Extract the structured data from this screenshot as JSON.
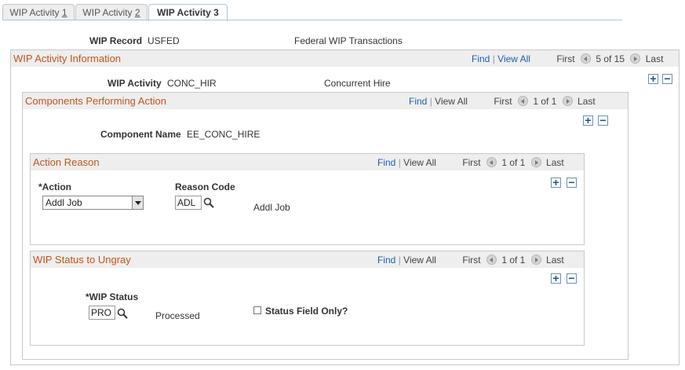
{
  "tabs": [
    {
      "prefix": "WIP Activity ",
      "hot": "1"
    },
    {
      "prefix": "WIP Activity ",
      "hot": "2"
    },
    {
      "label": "WIP Activity 3"
    }
  ],
  "header": {
    "wip_record_label": "WIP Record",
    "wip_record_value": "USFED",
    "wip_record_desc": "Federal WIP Transactions"
  },
  "wip_activity_info": {
    "title": "WIP Activity Information",
    "find": "Find",
    "view_all": "View All",
    "first": "First",
    "range": "5 of 15",
    "last": "Last",
    "activity_label": "WIP Activity",
    "activity_value": "CONC_HIR",
    "activity_desc": "Concurrent Hire"
  },
  "components": {
    "title": "Components Performing Action",
    "find": "Find",
    "view_all": "View All",
    "first": "First",
    "range": "1 of 1",
    "last": "Last",
    "name_label": "Component Name",
    "name_value": "EE_CONC_HIRE"
  },
  "action_reason": {
    "title": "Action Reason",
    "find": "Find",
    "view_all": "View All",
    "first": "First",
    "range": "1 of 1",
    "last": "Last",
    "action_label": "*Action",
    "action_value": "Addl Job",
    "reason_label": "Reason Code",
    "reason_value": "ADL",
    "reason_desc": "Addl Job"
  },
  "wip_status": {
    "title": "WIP Status to Ungray",
    "find": "Find",
    "view_all": "View All",
    "first": "First",
    "range": "1 of 1",
    "last": "Last",
    "status_label": "*WIP Status",
    "status_value": "PRO",
    "status_desc": "Processed",
    "checkbox_label": "Status Field Only?"
  },
  "controls": {
    "add": "+",
    "remove": "−"
  },
  "colors": {
    "section_title": "#c0561e",
    "link": "#1f5fa8",
    "header_bg": "#eeeeee",
    "border": "#c9c9c9"
  }
}
